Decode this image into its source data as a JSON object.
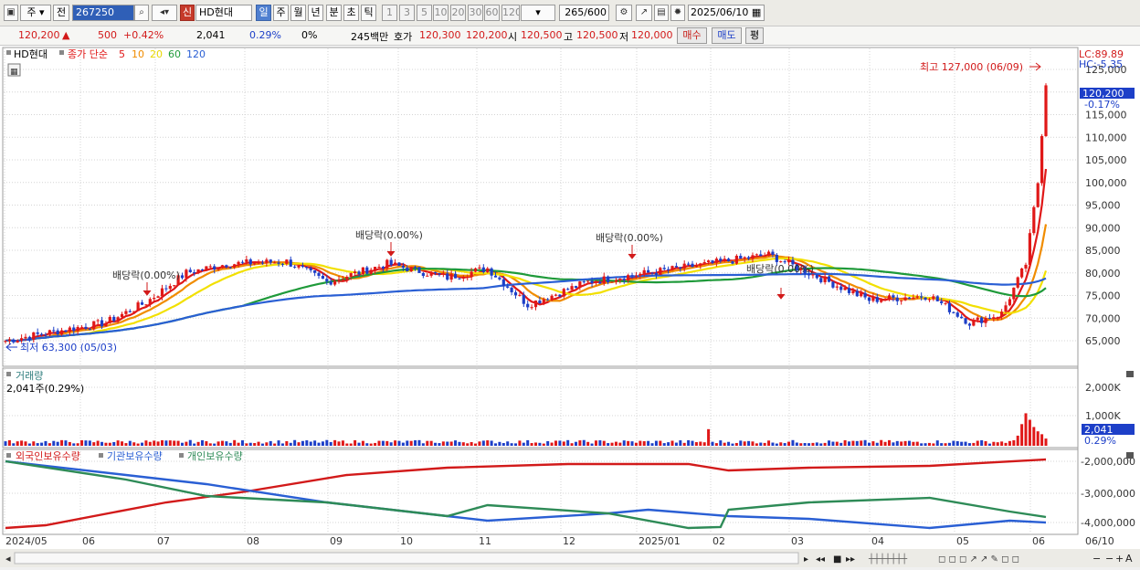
{
  "toolbar": {
    "period_select": "주",
    "prev_label": "전",
    "code": "267250",
    "shin_label": "신",
    "stock_name": "HD현대",
    "periods": [
      "일",
      "주",
      "월",
      "년",
      "분",
      "초",
      "틱"
    ],
    "active_period": "일",
    "intervals": [
      "1",
      "3",
      "5",
      "10",
      "20",
      "30",
      "60",
      "120"
    ],
    "count": "265",
    "count_total": "/600",
    "date": "2025/06/10"
  },
  "info": {
    "price": "120,200",
    "change_arrow": "▲",
    "change": "500",
    "change_pct": "+0.42%",
    "volume": "2,041",
    "volume_pct": "0.29%",
    "zero_pct": "0%",
    "amount": "245백만",
    "hoga_label": "호가",
    "ask": "120,300",
    "bid": "120,200",
    "open_label": "시",
    "open": "120,500",
    "high_label": "고",
    "high": "120,500",
    "low_label": "저",
    "low": "120,000",
    "buy_button": "매수",
    "sell_button": "매도",
    "avg_button": "평"
  },
  "legend": {
    "name": "HD현대",
    "ma_prefix": "종가 단순",
    "ma": [
      {
        "period": "5",
        "color": "#e01818"
      },
      {
        "period": "10",
        "color": "#f08c00"
      },
      {
        "period": "20",
        "color": "#f2e000"
      },
      {
        "period": "60",
        "color": "#1f9a3a"
      },
      {
        "period": "120",
        "color": "#2a5fd4"
      }
    ]
  },
  "price_panel": {
    "lc": "LC:89.89",
    "hc": "HC:-5.35",
    "current_tag": "120,200",
    "current_pct": "-0.17%",
    "high_note": "최고 127,000 (06/09)",
    "low_note": "최저 63,300 (05/03)",
    "dividend_label": "배당락(0.00%)",
    "y_ticks": [
      "125,000",
      "120,000",
      "115,000",
      "110,000",
      "105,000",
      "100,000",
      "95,000",
      "90,000",
      "85,000",
      "80,000",
      "75,000",
      "70,000",
      "65,000"
    ]
  },
  "volume_panel": {
    "title": "거래량",
    "value": "2,041주(0.29%)",
    "y_ticks": [
      "2,000K",
      "1,000K"
    ],
    "tag": "2,041",
    "tag_pct": "0.29%"
  },
  "holdings_panel": {
    "series": [
      {
        "name": "외국인보유수량",
        "color": "#d21a1a"
      },
      {
        "name": "기관보유수량",
        "color": "#2a5fd4"
      },
      {
        "name": "개인보유수량",
        "color": "#2e8b57"
      }
    ],
    "y_ticks": [
      "-2,000,000",
      "-3,000,000",
      "-4,000,000"
    ]
  },
  "x_axis": [
    "2024/05",
    "06",
    "07",
    "08",
    "09",
    "10",
    "11",
    "12",
    "2025/01",
    "02",
    "03",
    "04",
    "05",
    "06",
    "06/10"
  ],
  "colors": {
    "up": "#e01818",
    "down": "#1d3fc8",
    "ma5": "#e01818",
    "ma10": "#f08c00",
    "ma20": "#f2e000",
    "ma60": "#1f9a3a",
    "ma120": "#2a5fd4"
  }
}
